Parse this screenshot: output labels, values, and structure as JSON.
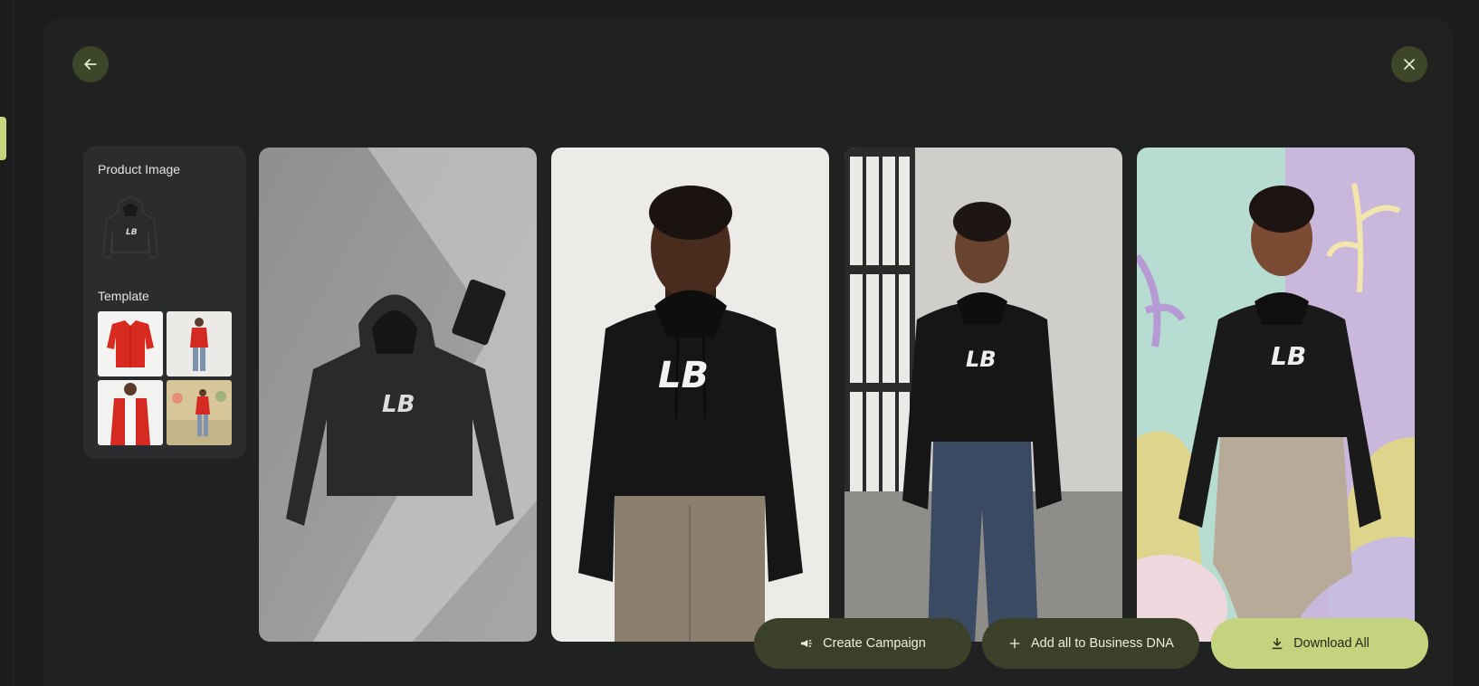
{
  "navigation": {
    "back_icon": "arrow-left-icon",
    "close_icon": "close-icon"
  },
  "sidebar": {
    "product_image_label": "Product Image",
    "template_label": "Template",
    "product_thumb_icon": "black-cropped-hoodie",
    "templates": [
      {
        "subject": "red jacket flat lay"
      },
      {
        "subject": "model red jacket full body"
      },
      {
        "subject": "model red jacket close up"
      },
      {
        "subject": "model red jacket floral room"
      }
    ]
  },
  "gallery": {
    "images": [
      {
        "subject": "black cropped hoodie flat lay on concrete",
        "logo": "LB"
      },
      {
        "subject": "model in black hoodie, neutral background",
        "logo": "LB"
      },
      {
        "subject": "model in black hoodie by window",
        "logo": "LB"
      },
      {
        "subject": "model in black hoodie, pastel floral backdrop",
        "logo": "LB"
      }
    ]
  },
  "actions": {
    "create_campaign": "Create Campaign",
    "add_all_dna": "Add all to Business DNA",
    "download_all": "Download All"
  },
  "colors": {
    "accent": "#c4d47e",
    "button_dark": "#3b4128",
    "background": "#1b1c1b",
    "panel": "#202221"
  }
}
